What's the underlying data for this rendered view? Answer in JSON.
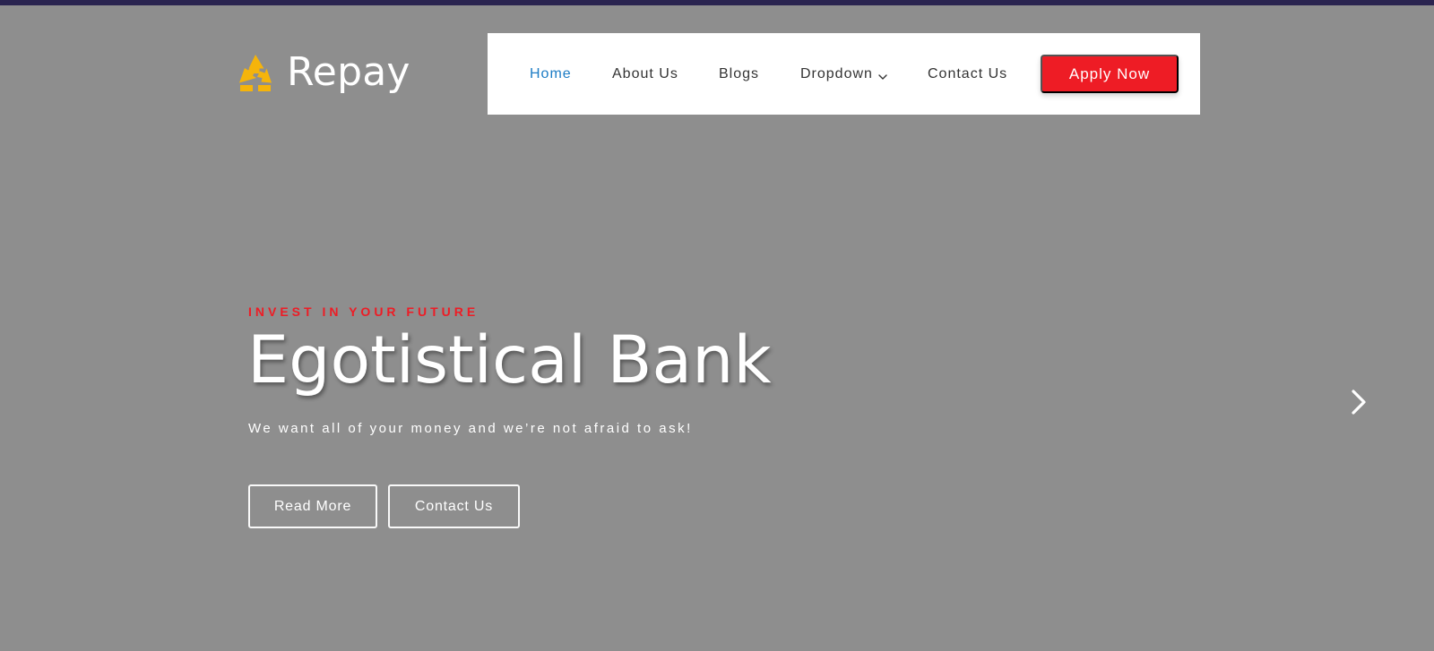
{
  "brand": {
    "name": "Repay",
    "logo_color": "#f5b40b",
    "text_color": "#ffffff"
  },
  "navigation": {
    "items": [
      {
        "label": "Home",
        "active": true
      },
      {
        "label": "About Us",
        "active": false
      },
      {
        "label": "Blogs",
        "active": false
      },
      {
        "label": "Dropdown",
        "active": false,
        "has_chevron": true
      },
      {
        "label": "Contact Us",
        "active": false
      }
    ],
    "cta": {
      "label": "Apply Now",
      "color": "#ee1c25"
    }
  },
  "hero": {
    "kicker": "INVEST IN YOUR FUTURE",
    "title": "Egotistical Bank",
    "subtitle": "We want all of your money and we’re not afraid to ask!",
    "buttons": {
      "read_more": "Read More",
      "contact_us": "Contact Us"
    }
  },
  "colors": {
    "top_bar": "#2a2450",
    "background": "#8e8e8e",
    "nav_active": "#1c7cc5",
    "accent": "#ee1c25"
  },
  "icons": {
    "logo": "recycle-icon",
    "dropdown": "chevron-down-icon",
    "next": "chevron-right-icon"
  }
}
